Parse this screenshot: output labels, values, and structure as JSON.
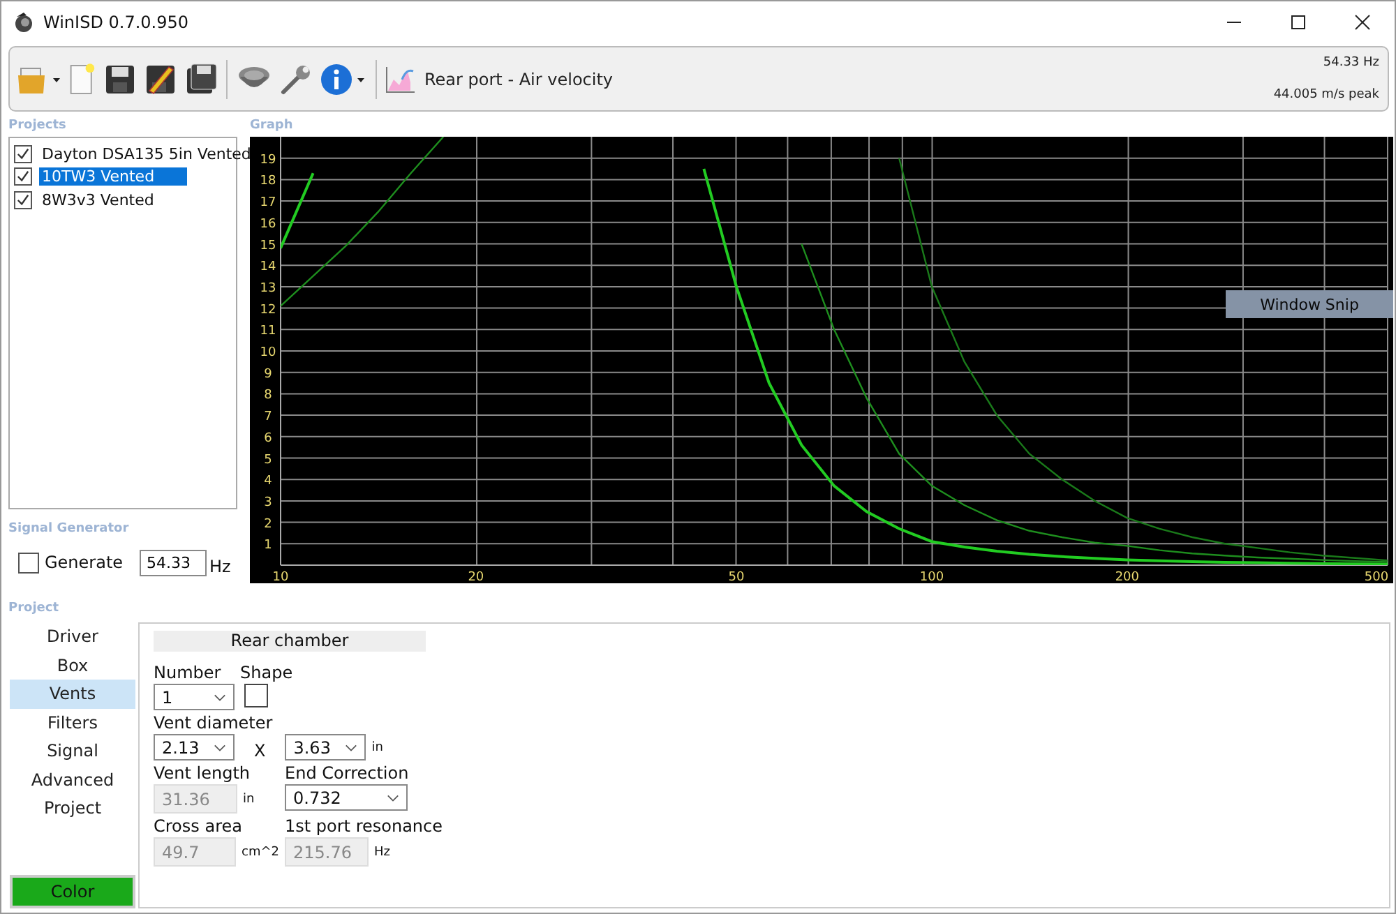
{
  "window": {
    "title": "WinISD 0.7.0.950"
  },
  "toolbar": {
    "graph_name": "Rear port - Air velocity",
    "readout_frequency": "54.33 Hz",
    "readout_value": "44.005 m/s peak"
  },
  "projects": {
    "label": "Projects",
    "items": [
      {
        "label": "Dayton DSA135 5in Vented",
        "checked": true,
        "selected": false
      },
      {
        "label": "10TW3 Vented",
        "checked": true,
        "selected": true
      },
      {
        "label": "8W3v3 Vented",
        "checked": true,
        "selected": false
      }
    ]
  },
  "graph": {
    "label": "Graph",
    "overlay_text": "Window Snip",
    "chart_data": {
      "type": "line",
      "categories": [
        "10",
        null,
        null,
        null,
        null,
        null,
        "20",
        null,
        null,
        null,
        null,
        null,
        null,
        null,
        "50",
        null,
        null,
        null,
        null,
        null,
        "100",
        null,
        null,
        null,
        null,
        null,
        "200",
        null,
        null,
        null,
        null,
        null,
        null,
        null,
        "500"
      ],
      "ylim": [
        0,
        20
      ],
      "grid": true,
      "yticks": [
        1,
        2,
        3,
        4,
        5,
        6,
        7,
        8,
        9,
        10,
        11,
        12,
        13,
        14,
        15,
        16,
        17,
        18,
        19
      ],
      "series": [
        {
          "color": "#22cc22",
          "values": [
            14.8,
            18.3,
            null,
            null,
            null,
            null,
            null,
            null,
            null,
            null,
            null,
            null,
            null,
            18.5,
            13,
            8.5,
            5.6,
            3.7,
            2.5,
            1.7,
            1.1,
            0.85,
            0.65,
            0.5,
            0.4,
            0.32,
            0.25,
            0.2,
            0.16,
            0.13,
            0.11,
            0.09,
            0.07,
            0.06,
            0.05
          ]
        },
        {
          "color": "#1e8e1e",
          "values": [
            12.1,
            13.5,
            14.9,
            16.5,
            18.3,
            20,
            null,
            null,
            null,
            null,
            null,
            null,
            null,
            null,
            null,
            null,
            15,
            11,
            7.8,
            5.2,
            3.7,
            2.8,
            2.1,
            1.6,
            1.3,
            1.05,
            0.9,
            0.7,
            0.55,
            0.45,
            0.36,
            0.3,
            0.24,
            0.19,
            0.15
          ]
        },
        {
          "color": "#1a7a1a",
          "values": [
            null,
            null,
            null,
            null,
            null,
            null,
            null,
            null,
            null,
            null,
            null,
            null,
            null,
            null,
            null,
            null,
            null,
            null,
            null,
            19,
            13,
            9.5,
            7,
            5.2,
            4,
            3,
            2.2,
            1.7,
            1.3,
            1,
            0.8,
            0.6,
            0.45,
            0.33,
            0.22
          ]
        }
      ]
    }
  },
  "signal_generator": {
    "label": "Signal Generator",
    "generate": {
      "label": "Generate",
      "checked": false
    },
    "frequency": "54.33",
    "unit": "Hz"
  },
  "project": {
    "label": "Project",
    "nav": [
      {
        "label": "Driver",
        "selected": false
      },
      {
        "label": "Box",
        "selected": false
      },
      {
        "label": "Vents",
        "selected": true
      },
      {
        "label": "Filters",
        "selected": false
      },
      {
        "label": "Signal",
        "selected": false
      },
      {
        "label": "Advanced",
        "selected": false
      },
      {
        "label": "Project",
        "selected": false
      }
    ],
    "color_button": "Color",
    "section_title": "Rear chamber",
    "number": {
      "label": "Number",
      "value": "1"
    },
    "shape": {
      "label": "Shape"
    },
    "vent_diameter": {
      "label": "Vent diameter",
      "value": "2.13",
      "separator": "X",
      "second_value": "3.63",
      "unit": "in"
    },
    "vent_length": {
      "label": "Vent length",
      "value": "31.36",
      "unit": "in",
      "disabled": true
    },
    "end_correction": {
      "label": "End Correction",
      "value": "0.732"
    },
    "cross_area": {
      "label": "Cross area",
      "value": "49.7",
      "unit": "cm^2",
      "disabled": true
    },
    "port_resonance": {
      "label": "1st port resonance",
      "value": "215.76",
      "unit": "Hz",
      "disabled": true
    }
  }
}
